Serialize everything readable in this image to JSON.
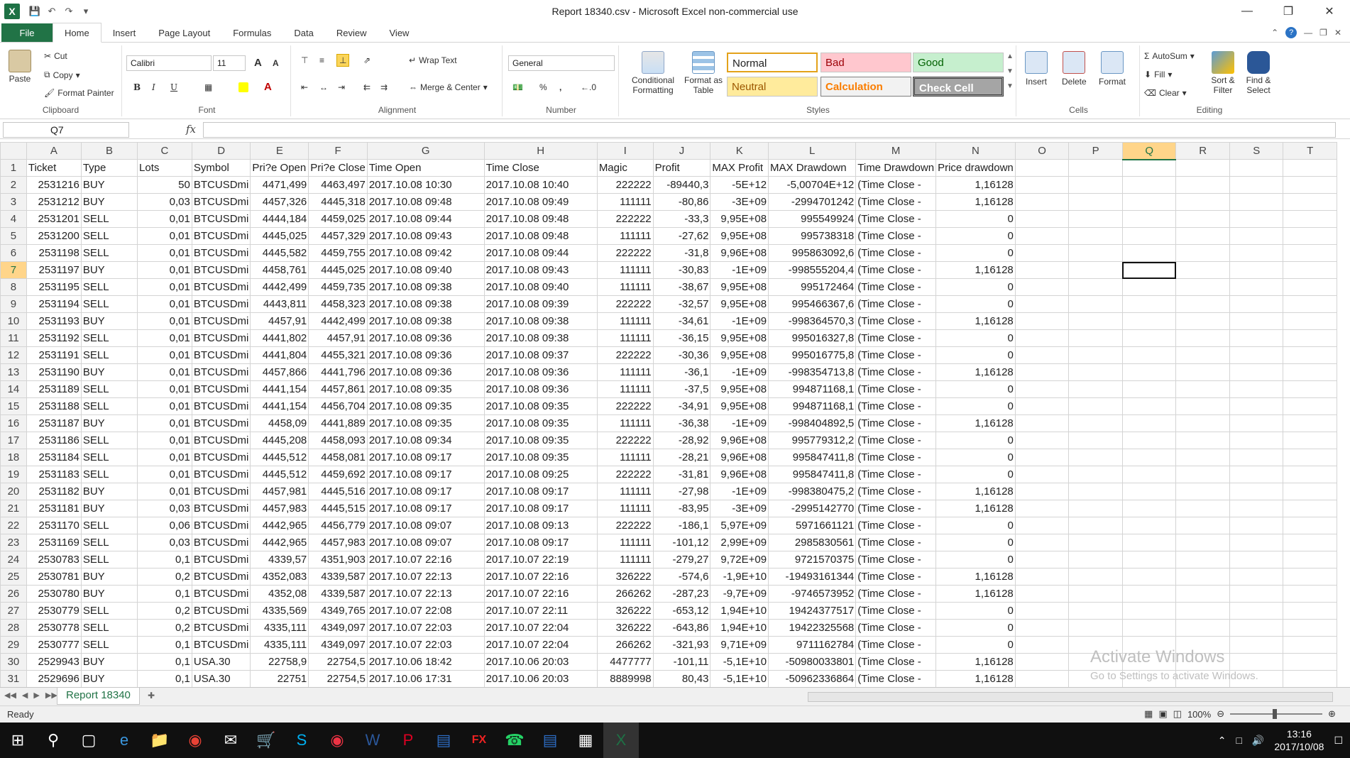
{
  "window": {
    "title": "Report 18340.csv  -  Microsoft Excel non-commercial use",
    "logo": "X"
  },
  "ribbon_tabs": [
    "File",
    "Home",
    "Insert",
    "Page Layout",
    "Formulas",
    "Data",
    "Review",
    "View"
  ],
  "ribbon": {
    "clipboard": {
      "paste": "Paste",
      "cut": "Cut",
      "copy": "Copy",
      "format_painter": "Format Painter",
      "label": "Clipboard"
    },
    "font": {
      "name": "Calibri",
      "size": "11",
      "label": "Font",
      "bold": "B",
      "italic": "I",
      "underline": "U",
      "grow": "A",
      "shrink": "A"
    },
    "alignment": {
      "wrap": "Wrap Text",
      "merge": "Merge & Center",
      "label": "Alignment"
    },
    "number": {
      "format": "General",
      "label": "Number",
      "percent": "%",
      "comma": ","
    },
    "styles": {
      "cond": "Conditional Formatting",
      "fmt_table": "Format as Table",
      "normal": "Normal",
      "bad": "Bad",
      "good": "Good",
      "neutral": "Neutral",
      "calculation": "Calculation",
      "check": "Check Cell",
      "label": "Styles"
    },
    "cells": {
      "insert": "Insert",
      "delete": "Delete",
      "format": "Format",
      "label": "Cells"
    },
    "editing": {
      "autosum": "AutoSum",
      "fill": "Fill",
      "clear": "Clear",
      "sort": "Sort & Filter",
      "find": "Find & Select",
      "label": "Editing"
    }
  },
  "formula_bar": {
    "name_box": "Q7",
    "fx": "fx",
    "value": ""
  },
  "columns": [
    "A",
    "B",
    "C",
    "D",
    "E",
    "F",
    "G",
    "H",
    "I",
    "J",
    "K",
    "L",
    "M",
    "N",
    "O",
    "P",
    "Q",
    "R",
    "S",
    "T"
  ],
  "selected_cell": {
    "col": "Q",
    "row": 7
  },
  "rows": [
    [
      "Ticket",
      "Type",
      "Lots",
      "Symbol",
      "Pri?e Open",
      "Pri?e Close",
      "Time Open",
      "Time Close",
      "Magic",
      "Profit",
      "MAX Profit",
      "MAX Drawdown",
      "Time Drawdown",
      "Price drawdown"
    ],
    [
      "2531216",
      "BUY",
      "50",
      "BTCUSDmi",
      "4471,499",
      "4463,497",
      "2017.10.08 10:30",
      "2017.10.08 10:40",
      "222222",
      "-89440,3",
      "-5E+12",
      "-5,00704E+12",
      "(Time Close -",
      "1,16128"
    ],
    [
      "2531212",
      "BUY",
      "0,03",
      "BTCUSDmi",
      "4457,326",
      "4445,318",
      "2017.10.08 09:48",
      "2017.10.08 09:49",
      "111111",
      "-80,86",
      "-3E+09",
      "-2994701242",
      "(Time Close -",
      "1,16128"
    ],
    [
      "2531201",
      "SELL",
      "0,01",
      "BTCUSDmi",
      "4444,184",
      "4459,025",
      "2017.10.08 09:44",
      "2017.10.08 09:48",
      "222222",
      "-33,3",
      "9,95E+08",
      "995549924",
      "(Time Close -",
      "0"
    ],
    [
      "2531200",
      "SELL",
      "0,01",
      "BTCUSDmi",
      "4445,025",
      "4457,329",
      "2017.10.08 09:43",
      "2017.10.08 09:48",
      "111111",
      "-27,62",
      "9,95E+08",
      "995738318",
      "(Time Close -",
      "0"
    ],
    [
      "2531198",
      "SELL",
      "0,01",
      "BTCUSDmi",
      "4445,582",
      "4459,755",
      "2017.10.08 09:42",
      "2017.10.08 09:44",
      "222222",
      "-31,8",
      "9,96E+08",
      "995863092,6",
      "(Time Close -",
      "0"
    ],
    [
      "2531197",
      "BUY",
      "0,01",
      "BTCUSDmi",
      "4458,761",
      "4445,025",
      "2017.10.08 09:40",
      "2017.10.08 09:43",
      "111111",
      "-30,83",
      "-1E+09",
      "-998555204,4",
      "(Time Close -",
      "1,16128"
    ],
    [
      "2531195",
      "SELL",
      "0,01",
      "BTCUSDmi",
      "4442,499",
      "4459,735",
      "2017.10.08 09:38",
      "2017.10.08 09:40",
      "111111",
      "-38,67",
      "9,95E+08",
      "995172464",
      "(Time Close -",
      "0"
    ],
    [
      "2531194",
      "SELL",
      "0,01",
      "BTCUSDmi",
      "4443,811",
      "4458,323",
      "2017.10.08 09:38",
      "2017.10.08 09:39",
      "222222",
      "-32,57",
      "9,95E+08",
      "995466367,6",
      "(Time Close -",
      "0"
    ],
    [
      "2531193",
      "BUY",
      "0,01",
      "BTCUSDmi",
      "4457,91",
      "4442,499",
      "2017.10.08 09:38",
      "2017.10.08 09:38",
      "111111",
      "-34,61",
      "-1E+09",
      "-998364570,3",
      "(Time Close -",
      "1,16128"
    ],
    [
      "2531192",
      "SELL",
      "0,01",
      "BTCUSDmi",
      "4441,802",
      "4457,91",
      "2017.10.08 09:36",
      "2017.10.08 09:38",
      "111111",
      "-36,15",
      "9,95E+08",
      "995016327,8",
      "(Time Close -",
      "0"
    ],
    [
      "2531191",
      "SELL",
      "0,01",
      "BTCUSDmi",
      "4441,804",
      "4455,321",
      "2017.10.08 09:36",
      "2017.10.08 09:37",
      "222222",
      "-30,36",
      "9,95E+08",
      "995016775,8",
      "(Time Close -",
      "0"
    ],
    [
      "2531190",
      "BUY",
      "0,01",
      "BTCUSDmi",
      "4457,866",
      "4441,796",
      "2017.10.08 09:36",
      "2017.10.08 09:36",
      "111111",
      "-36,1",
      "-1E+09",
      "-998354713,8",
      "(Time Close -",
      "1,16128"
    ],
    [
      "2531189",
      "SELL",
      "0,01",
      "BTCUSDmi",
      "4441,154",
      "4457,861",
      "2017.10.08 09:35",
      "2017.10.08 09:36",
      "111111",
      "-37,5",
      "9,95E+08",
      "994871168,1",
      "(Time Close -",
      "0"
    ],
    [
      "2531188",
      "SELL",
      "0,01",
      "BTCUSDmi",
      "4441,154",
      "4456,704",
      "2017.10.08 09:35",
      "2017.10.08 09:35",
      "222222",
      "-34,91",
      "9,95E+08",
      "994871168,1",
      "(Time Close -",
      "0"
    ],
    [
      "2531187",
      "BUY",
      "0,01",
      "BTCUSDmi",
      "4458,09",
      "4441,889",
      "2017.10.08 09:35",
      "2017.10.08 09:35",
      "111111",
      "-36,38",
      "-1E+09",
      "-998404892,5",
      "(Time Close -",
      "1,16128"
    ],
    [
      "2531186",
      "SELL",
      "0,01",
      "BTCUSDmi",
      "4445,208",
      "4458,093",
      "2017.10.08 09:34",
      "2017.10.08 09:35",
      "222222",
      "-28,92",
      "9,96E+08",
      "995779312,2",
      "(Time Close -",
      "0"
    ],
    [
      "2531184",
      "SELL",
      "0,01",
      "BTCUSDmi",
      "4445,512",
      "4458,081",
      "2017.10.08 09:17",
      "2017.10.08 09:35",
      "111111",
      "-28,21",
      "9,96E+08",
      "995847411,8",
      "(Time Close -",
      "0"
    ],
    [
      "2531183",
      "SELL",
      "0,01",
      "BTCUSDmi",
      "4445,512",
      "4459,692",
      "2017.10.08 09:17",
      "2017.10.08 09:25",
      "222222",
      "-31,81",
      "9,96E+08",
      "995847411,8",
      "(Time Close -",
      "0"
    ],
    [
      "2531182",
      "BUY",
      "0,01",
      "BTCUSDmi",
      "4457,981",
      "4445,516",
      "2017.10.08 09:17",
      "2017.10.08 09:17",
      "111111",
      "-27,98",
      "-1E+09",
      "-998380475,2",
      "(Time Close -",
      "1,16128"
    ],
    [
      "2531181",
      "BUY",
      "0,03",
      "BTCUSDmi",
      "4457,983",
      "4445,515",
      "2017.10.08 09:17",
      "2017.10.08 09:17",
      "111111",
      "-83,95",
      "-3E+09",
      "-2995142770",
      "(Time Close -",
      "1,16128"
    ],
    [
      "2531170",
      "SELL",
      "0,06",
      "BTCUSDmi",
      "4442,965",
      "4456,779",
      "2017.10.08 09:07",
      "2017.10.08 09:13",
      "222222",
      "-186,1",
      "5,97E+09",
      "5971661121",
      "(Time Close -",
      "0"
    ],
    [
      "2531169",
      "SELL",
      "0,03",
      "BTCUSDmi",
      "4442,965",
      "4457,983",
      "2017.10.08 09:07",
      "2017.10.08 09:17",
      "111111",
      "-101,12",
      "2,99E+09",
      "2985830561",
      "(Time Close -",
      "0"
    ],
    [
      "2530783",
      "SELL",
      "0,1",
      "BTCUSDmi",
      "4339,57",
      "4351,903",
      "2017.10.07 22:16",
      "2017.10.07 22:19",
      "111111",
      "-279,27",
      "9,72E+09",
      "9721570375",
      "(Time Close -",
      "0"
    ],
    [
      "2530781",
      "BUY",
      "0,2",
      "BTCUSDmi",
      "4352,083",
      "4339,587",
      "2017.10.07 22:13",
      "2017.10.07 22:16",
      "326222",
      "-574,6",
      "-1,9E+10",
      "-19493161344",
      "(Time Close -",
      "1,16128"
    ],
    [
      "2530780",
      "BUY",
      "0,1",
      "BTCUSDmi",
      "4352,08",
      "4339,587",
      "2017.10.07 22:13",
      "2017.10.07 22:16",
      "266262",
      "-287,23",
      "-9,7E+09",
      "-9746573952",
      "(Time Close -",
      "1,16128"
    ],
    [
      "2530779",
      "SELL",
      "0,2",
      "BTCUSDmi",
      "4335,569",
      "4349,765",
      "2017.10.07 22:08",
      "2017.10.07 22:11",
      "326222",
      "-653,12",
      "1,94E+10",
      "19424377517",
      "(Time Close -",
      "0"
    ],
    [
      "2530778",
      "SELL",
      "0,2",
      "BTCUSDmi",
      "4335,111",
      "4349,097",
      "2017.10.07 22:03",
      "2017.10.07 22:04",
      "326222",
      "-643,86",
      "1,94E+10",
      "19422325568",
      "(Time Close -",
      "0"
    ],
    [
      "2530777",
      "SELL",
      "0,1",
      "BTCUSDmi",
      "4335,111",
      "4349,097",
      "2017.10.07 22:03",
      "2017.10.07 22:04",
      "266262",
      "-321,93",
      "9,71E+09",
      "9711162784",
      "(Time Close -",
      "0"
    ],
    [
      "2529943",
      "BUY",
      "0,1",
      "USA.30",
      "22758,9",
      "22754,5",
      "2017.10.06 18:42",
      "2017.10.06 20:03",
      "4477777",
      "-101,11",
      "-5,1E+10",
      "-50980033801",
      "(Time Close -",
      "1,16128"
    ],
    [
      "2529696",
      "BUY",
      "0,1",
      "USA.30",
      "22751",
      "22754,5",
      "2017.10.06 17:31",
      "2017.10.06 20:03",
      "8889998",
      "80,43",
      "-5,1E+10",
      "-50962336864",
      "(Time Close -",
      "1,16128"
    ]
  ],
  "sheet_tab": "Report 18340",
  "status": {
    "ready": "Ready",
    "zoom": "100%"
  },
  "watermark": {
    "line1": "Activate Windows",
    "line2": "Go to Settings to activate Windows."
  },
  "taskbar": {
    "time": "13:16",
    "date": "2017/10/08"
  },
  "colors": {
    "excel_green": "#217346",
    "selected_header": "#ffd58a"
  }
}
